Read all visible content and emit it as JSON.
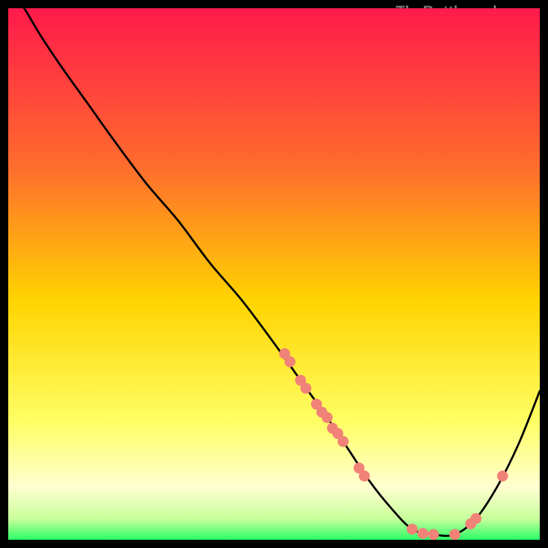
{
  "watermark": "TheBottleneck.com",
  "chart_data": {
    "type": "line",
    "title": "",
    "xlabel": "",
    "ylabel": "",
    "xlim": [
      0,
      100
    ],
    "ylim": [
      0,
      100
    ],
    "grid": false,
    "legend": false,
    "gradient_stops": [
      {
        "offset": 0,
        "color": "#ff1a4b"
      },
      {
        "offset": 0.3,
        "color": "#ff6d2d"
      },
      {
        "offset": 0.55,
        "color": "#ffd400"
      },
      {
        "offset": 0.78,
        "color": "#ffff66"
      },
      {
        "offset": 0.9,
        "color": "#ffffd0"
      },
      {
        "offset": 0.96,
        "color": "#c9ff9c"
      },
      {
        "offset": 1.0,
        "color": "#2bff66"
      }
    ],
    "series": [
      {
        "name": "bottleneck-curve",
        "color": "#000000",
        "x": [
          0,
          3,
          6,
          10,
          15,
          20,
          26,
          32,
          38,
          44,
          50,
          55,
          60,
          64,
          68,
          72,
          76,
          80,
          84,
          88,
          92,
          96,
          100
        ],
        "y": [
          104,
          100,
          95,
          89,
          82,
          75,
          67,
          60,
          52,
          45,
          37,
          30,
          23,
          17,
          11,
          6,
          2,
          1,
          1,
          4,
          10,
          18,
          28
        ]
      }
    ],
    "markers": {
      "name": "highlighted-points",
      "color": "#f08278",
      "radius": 8,
      "points": [
        {
          "x": 52,
          "y": 35
        },
        {
          "x": 53,
          "y": 33.5
        },
        {
          "x": 55,
          "y": 30
        },
        {
          "x": 56,
          "y": 28.5
        },
        {
          "x": 58,
          "y": 25.5
        },
        {
          "x": 59,
          "y": 24
        },
        {
          "x": 60,
          "y": 23
        },
        {
          "x": 61,
          "y": 21
        },
        {
          "x": 62,
          "y": 20
        },
        {
          "x": 63,
          "y": 18.5
        },
        {
          "x": 66,
          "y": 13.5
        },
        {
          "x": 67,
          "y": 12
        },
        {
          "x": 76,
          "y": 2
        },
        {
          "x": 78,
          "y": 1.2
        },
        {
          "x": 80,
          "y": 1
        },
        {
          "x": 84,
          "y": 1
        },
        {
          "x": 87,
          "y": 3
        },
        {
          "x": 88,
          "y": 4
        },
        {
          "x": 93,
          "y": 12
        }
      ]
    }
  }
}
